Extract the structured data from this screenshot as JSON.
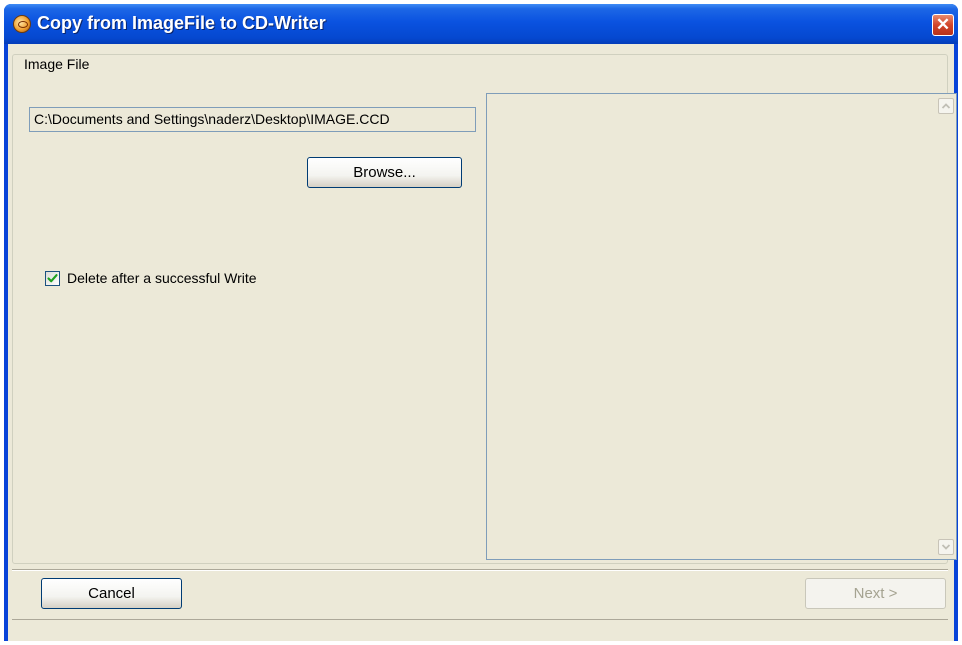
{
  "window": {
    "title": "Copy from ImageFile to CD-Writer",
    "app_icon": "cd-writer-app-icon",
    "close_glyph": "✕"
  },
  "image_file_group": {
    "label": "Image File",
    "path_value": "C:\\Documents and Settings\\naderz\\Desktop\\IMAGE.CCD",
    "browse_label": "Browse...",
    "delete_checkbox": {
      "label": "Delete after a successful Write",
      "checked": true
    }
  },
  "footer": {
    "cancel_label": "Cancel",
    "next_label": "Next >",
    "next_enabled": false
  },
  "colors": {
    "titlebar": "#0a52e0",
    "face": "#ece9d8",
    "close_button": "#d2452a",
    "checkmark": "#21a121"
  }
}
